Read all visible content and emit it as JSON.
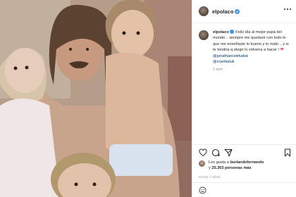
{
  "post": {
    "username": "elpolaco",
    "photo_alt": "Foto familiar con tres niños",
    "caption": {
      "username": "elpolaco",
      "text": "Feliz día al mejor papá del mundo .. siempre me quedaré con todo lo que me enseñaste lo bueno y lo malo .. y si te tendría q elegir lo volvería a hacer !",
      "heart": "❤",
      "mentions": [
        "@jonathancwirkaluk",
        "@rcwirkaluk"
      ],
      "time_ago": "1 sem"
    },
    "likes": {
      "prefix": "Les gusta a",
      "liker": "burlandofernando",
      "connector": "y",
      "count": "25.303",
      "suffix": "personas más"
    },
    "date": "HACE 7 DÍAS"
  },
  "icons": {
    "verified": "verified-badge-icon",
    "more": "more-options-icon",
    "like": "heart-icon",
    "comment": "comment-icon",
    "share": "share-icon",
    "save": "bookmark-icon",
    "emoji": "emoji-icon"
  },
  "colors": {
    "verified_blue": "#3897f0",
    "mention_blue": "#00376b",
    "heart_red": "#ed4956",
    "muted": "#8e8e8e"
  }
}
